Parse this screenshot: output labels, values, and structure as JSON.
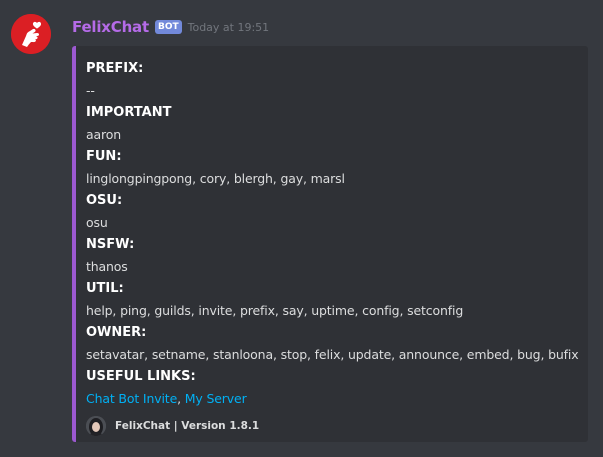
{
  "message": {
    "author": "FelixChat",
    "bot_tag": "BOT",
    "timestamp": "Today at 19:51",
    "author_color": "#b56be8"
  },
  "embed": {
    "accent_color": "#9c59d1",
    "fields": [
      {
        "name": "PREFIX:",
        "value": "--"
      },
      {
        "name": "IMPORTANT",
        "value": "aaron"
      },
      {
        "name": "FUN:",
        "value": "linglongpingpong, cory, blergh, gay, marsl"
      },
      {
        "name": "OSU:",
        "value": "osu"
      },
      {
        "name": "NSFW:",
        "value": "thanos"
      },
      {
        "name": "UTIL:",
        "value": "help, ping, guilds, invite, prefix, say, uptime, config, setconfig"
      },
      {
        "name": "OWNER:",
        "value": "setavatar, setname, stanloona, stop, felix, update, announce, embed, bug, bufix"
      },
      {
        "name": "USEFUL LINKS:"
      }
    ],
    "links": {
      "invite": "Chat Bot Invite",
      "separator": ", ",
      "server": "My Server"
    },
    "footer": {
      "text": "FelixChat | Version 1.8.1"
    }
  },
  "icons": {
    "avatar": "finger-heart-avatar-icon",
    "footer": "felix-avatar-icon"
  }
}
